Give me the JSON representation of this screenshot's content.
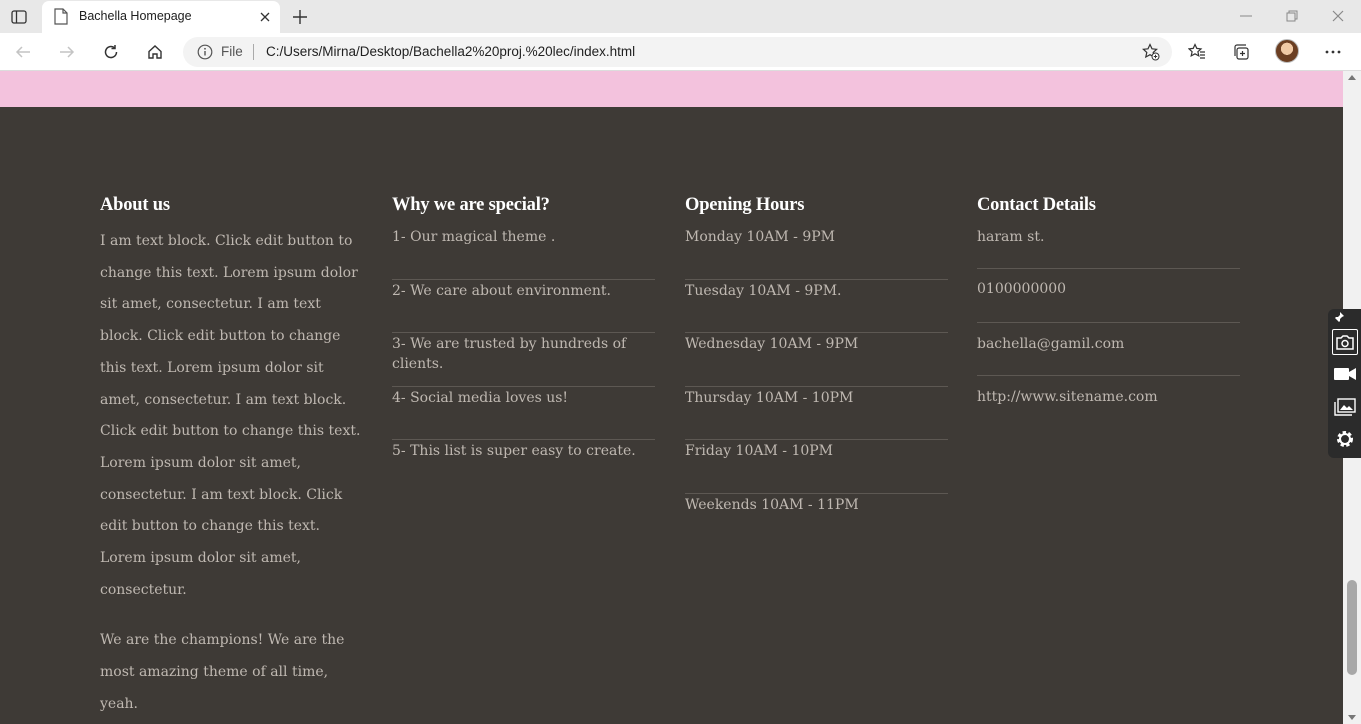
{
  "browser": {
    "tab": {
      "title": "Bachella Homepage"
    },
    "address_bar": {
      "scheme_label": "File",
      "url": "C:/Users/Mirna/Desktop/Bachella2%20proj.%20lec/index.html"
    }
  },
  "page": {
    "colors": {
      "pink_band": "#f3c2dd",
      "footer_bg": "#3e3a36",
      "heading": "#ffffff",
      "text": "#bfb8b1"
    },
    "footer": {
      "about": {
        "heading": "About us",
        "paragraphs": [
          "I am text block. Click edit button to change this text. Lorem ipsum dolor sit amet, consectetur. I am text block. Click edit button to change this text. Lorem ipsum dolor sit amet, consectetur. I am text block. Click edit button to change this text. Lorem ipsum dolor sit amet, consectetur. I am text block. Click edit button to change this text. Lorem ipsum dolor sit amet, consectetur.",
          "We are the champions! We are the most amazing theme of all time, yeah."
        ]
      },
      "special": {
        "heading": "Why we are special?",
        "items": [
          "1- Our magical theme .",
          "2- We care about environment.",
          "3- We are trusted by hundreds of clients.",
          "4- Social media loves us!",
          "5- This list is super easy to create."
        ]
      },
      "hours": {
        "heading": "Opening Hours",
        "items": [
          "Monday 10AM - 9PM",
          "Tuesday 10AM - 9PM.",
          "Wednesday 10AM - 9PM",
          "Thursday 10AM - 10PM",
          "Friday 10AM - 10PM",
          "Weekends 10AM - 11PM"
        ]
      },
      "contact": {
        "heading": "Contact Details",
        "items": [
          "haram st.",
          "0100000000",
          "bachella@gamil.com",
          "http://www.sitename.com"
        ]
      }
    }
  },
  "icons": {
    "tab_actions": "tab-actions-icon",
    "favicon": "document-icon",
    "close": "close-icon",
    "new_tab": "plus-icon",
    "back": "back-arrow-icon",
    "forward": "forward-arrow-icon",
    "refresh": "refresh-icon",
    "home": "home-icon",
    "info": "info-icon",
    "add_favorite": "add-favorite-icon",
    "favorites": "favorites-icon",
    "collections": "collections-icon",
    "menu": "more-icon",
    "capture": [
      "pin-icon",
      "camera-icon",
      "video-icon",
      "gallery-icon",
      "settings-icon"
    ]
  }
}
